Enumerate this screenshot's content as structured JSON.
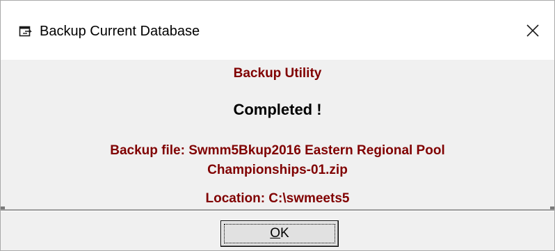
{
  "window": {
    "title": "Backup Current Database",
    "icon": "window-app-icon",
    "close_icon": "close-icon"
  },
  "content": {
    "heading": "Backup Utility",
    "status": "Completed !",
    "file_line_1": "Backup file: Swmm5Bkup2016 Eastern Regional Pool",
    "file_line_2": "Championships-01.zip",
    "location": "Location: C:\\swmeets5"
  },
  "footer": {
    "ok_mnemonic": "O",
    "ok_rest": "K"
  },
  "colors": {
    "accent_text": "#800000",
    "dialog_bg": "#f0f0f0",
    "button_bg": "#e1e1e1"
  }
}
